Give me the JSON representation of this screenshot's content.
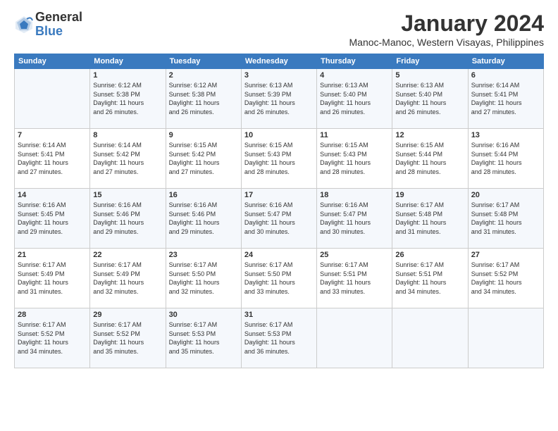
{
  "logo": {
    "general": "General",
    "blue": "Blue"
  },
  "title": "January 2024",
  "location": "Manoc-Manoc, Western Visayas, Philippines",
  "headers": [
    "Sunday",
    "Monday",
    "Tuesday",
    "Wednesday",
    "Thursday",
    "Friday",
    "Saturday"
  ],
  "weeks": [
    [
      {
        "day": "",
        "info": ""
      },
      {
        "day": "1",
        "info": "Sunrise: 6:12 AM\nSunset: 5:38 PM\nDaylight: 11 hours\nand 26 minutes."
      },
      {
        "day": "2",
        "info": "Sunrise: 6:12 AM\nSunset: 5:38 PM\nDaylight: 11 hours\nand 26 minutes."
      },
      {
        "day": "3",
        "info": "Sunrise: 6:13 AM\nSunset: 5:39 PM\nDaylight: 11 hours\nand 26 minutes."
      },
      {
        "day": "4",
        "info": "Sunrise: 6:13 AM\nSunset: 5:40 PM\nDaylight: 11 hours\nand 26 minutes."
      },
      {
        "day": "5",
        "info": "Sunrise: 6:13 AM\nSunset: 5:40 PM\nDaylight: 11 hours\nand 26 minutes."
      },
      {
        "day": "6",
        "info": "Sunrise: 6:14 AM\nSunset: 5:41 PM\nDaylight: 11 hours\nand 27 minutes."
      }
    ],
    [
      {
        "day": "7",
        "info": "Sunrise: 6:14 AM\nSunset: 5:41 PM\nDaylight: 11 hours\nand 27 minutes."
      },
      {
        "day": "8",
        "info": "Sunrise: 6:14 AM\nSunset: 5:42 PM\nDaylight: 11 hours\nand 27 minutes."
      },
      {
        "day": "9",
        "info": "Sunrise: 6:15 AM\nSunset: 5:42 PM\nDaylight: 11 hours\nand 27 minutes."
      },
      {
        "day": "10",
        "info": "Sunrise: 6:15 AM\nSunset: 5:43 PM\nDaylight: 11 hours\nand 28 minutes."
      },
      {
        "day": "11",
        "info": "Sunrise: 6:15 AM\nSunset: 5:43 PM\nDaylight: 11 hours\nand 28 minutes."
      },
      {
        "day": "12",
        "info": "Sunrise: 6:15 AM\nSunset: 5:44 PM\nDaylight: 11 hours\nand 28 minutes."
      },
      {
        "day": "13",
        "info": "Sunrise: 6:16 AM\nSunset: 5:44 PM\nDaylight: 11 hours\nand 28 minutes."
      }
    ],
    [
      {
        "day": "14",
        "info": "Sunrise: 6:16 AM\nSunset: 5:45 PM\nDaylight: 11 hours\nand 29 minutes."
      },
      {
        "day": "15",
        "info": "Sunrise: 6:16 AM\nSunset: 5:46 PM\nDaylight: 11 hours\nand 29 minutes."
      },
      {
        "day": "16",
        "info": "Sunrise: 6:16 AM\nSunset: 5:46 PM\nDaylight: 11 hours\nand 29 minutes."
      },
      {
        "day": "17",
        "info": "Sunrise: 6:16 AM\nSunset: 5:47 PM\nDaylight: 11 hours\nand 30 minutes."
      },
      {
        "day": "18",
        "info": "Sunrise: 6:16 AM\nSunset: 5:47 PM\nDaylight: 11 hours\nand 30 minutes."
      },
      {
        "day": "19",
        "info": "Sunrise: 6:17 AM\nSunset: 5:48 PM\nDaylight: 11 hours\nand 31 minutes."
      },
      {
        "day": "20",
        "info": "Sunrise: 6:17 AM\nSunset: 5:48 PM\nDaylight: 11 hours\nand 31 minutes."
      }
    ],
    [
      {
        "day": "21",
        "info": "Sunrise: 6:17 AM\nSunset: 5:49 PM\nDaylight: 11 hours\nand 31 minutes."
      },
      {
        "day": "22",
        "info": "Sunrise: 6:17 AM\nSunset: 5:49 PM\nDaylight: 11 hours\nand 32 minutes."
      },
      {
        "day": "23",
        "info": "Sunrise: 6:17 AM\nSunset: 5:50 PM\nDaylight: 11 hours\nand 32 minutes."
      },
      {
        "day": "24",
        "info": "Sunrise: 6:17 AM\nSunset: 5:50 PM\nDaylight: 11 hours\nand 33 minutes."
      },
      {
        "day": "25",
        "info": "Sunrise: 6:17 AM\nSunset: 5:51 PM\nDaylight: 11 hours\nand 33 minutes."
      },
      {
        "day": "26",
        "info": "Sunrise: 6:17 AM\nSunset: 5:51 PM\nDaylight: 11 hours\nand 34 minutes."
      },
      {
        "day": "27",
        "info": "Sunrise: 6:17 AM\nSunset: 5:52 PM\nDaylight: 11 hours\nand 34 minutes."
      }
    ],
    [
      {
        "day": "28",
        "info": "Sunrise: 6:17 AM\nSunset: 5:52 PM\nDaylight: 11 hours\nand 34 minutes."
      },
      {
        "day": "29",
        "info": "Sunrise: 6:17 AM\nSunset: 5:52 PM\nDaylight: 11 hours\nand 35 minutes."
      },
      {
        "day": "30",
        "info": "Sunrise: 6:17 AM\nSunset: 5:53 PM\nDaylight: 11 hours\nand 35 minutes."
      },
      {
        "day": "31",
        "info": "Sunrise: 6:17 AM\nSunset: 5:53 PM\nDaylight: 11 hours\nand 36 minutes."
      },
      {
        "day": "",
        "info": ""
      },
      {
        "day": "",
        "info": ""
      },
      {
        "day": "",
        "info": ""
      }
    ]
  ]
}
